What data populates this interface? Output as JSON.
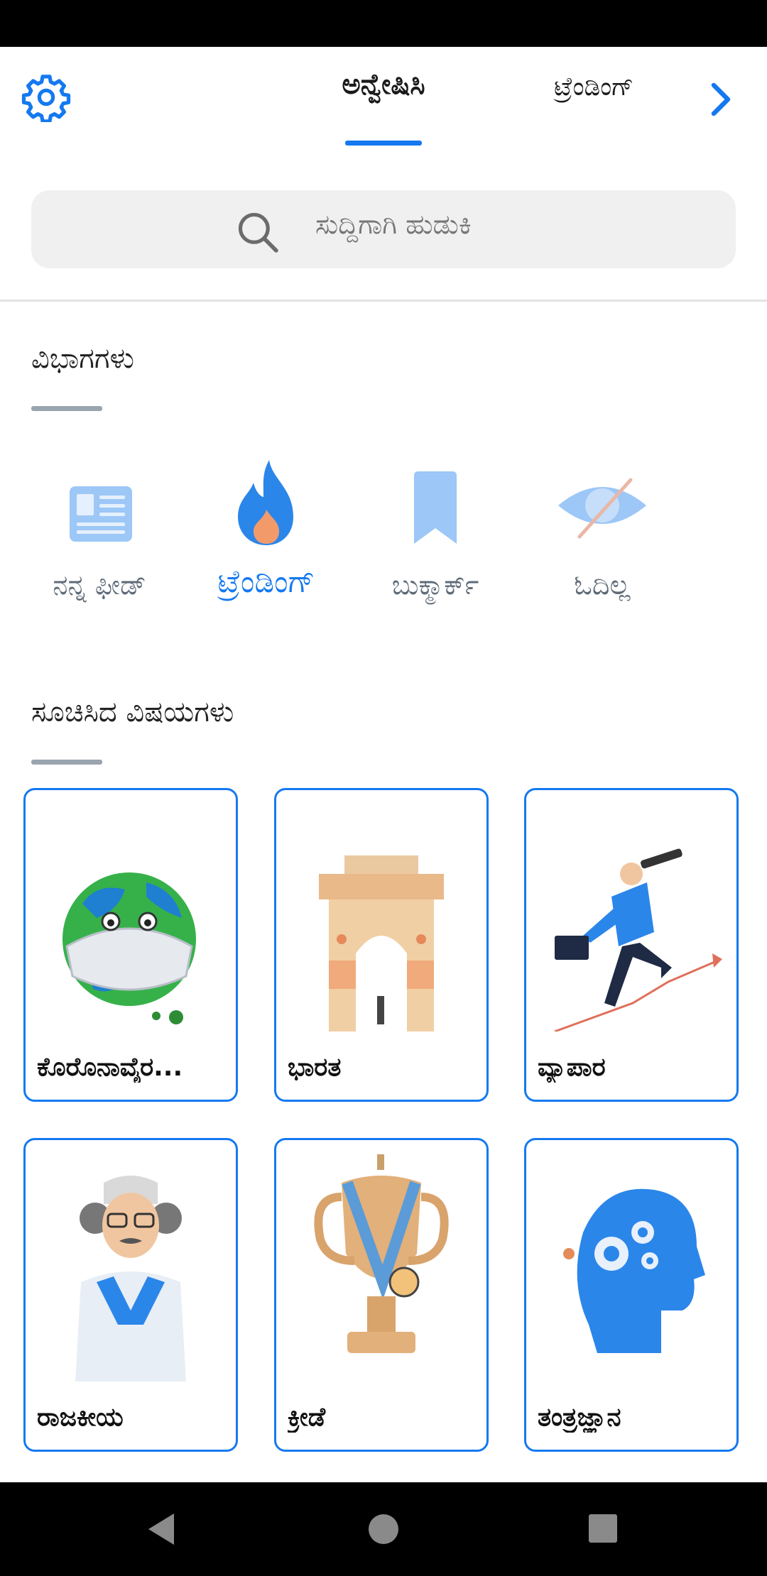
{
  "header": {
    "tab_explore": "ಅನ್ವೇಷಿಸಿ",
    "tab_trending": "ಟ್ರೆಂಡಿಂಗ್",
    "settings_icon": "gear-icon",
    "next_icon": "chevron-right-icon"
  },
  "search": {
    "placeholder": "ಸುದ್ದಿಗಾಗಿ ಹುಡುಕಿ"
  },
  "sections": {
    "categories_title": "ವಿಭಾಗಗಳು",
    "topics_title": "ಸೂಚಿಸಿದ ವಿಷಯಗಳು"
  },
  "categories": [
    {
      "label": "ನನ್ನ ಫೀಡ್",
      "icon": "newspaper-icon"
    },
    {
      "label": "ಟ್ರೆಂಡಿಂಗ್",
      "icon": "flame-icon",
      "active": true
    },
    {
      "label": "ಬುಕ್ಮಾರ್ಕ್",
      "icon": "bookmark-icon"
    },
    {
      "label": "ಓದಿಲ್ಲ",
      "icon": "eye-off-icon"
    }
  ],
  "topics": [
    {
      "label": "ಕೊರೊನಾವೈರ...",
      "image": "globe-mask"
    },
    {
      "label": "ಭಾರತ",
      "image": "india-gate"
    },
    {
      "label": "ವ್ಯಾಪಾರ",
      "image": "businessman-telescope"
    },
    {
      "label": "ರಾಜಕೀಯ",
      "image": "politician"
    },
    {
      "label": "ಕ್ರೀಡೆ",
      "image": "trophy-medal"
    },
    {
      "label": "ತಂತ್ರಜ್ಞಾನ",
      "image": "head-gears"
    }
  ],
  "colors": {
    "accent": "#1479f0",
    "icon_light": "#9cc7f7"
  }
}
